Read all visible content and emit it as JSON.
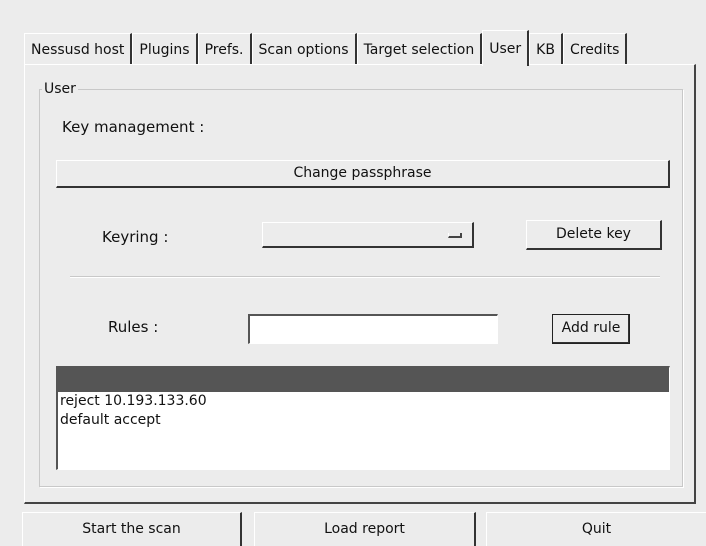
{
  "tabs": [
    {
      "label": "Nessusd host"
    },
    {
      "label": "Plugins"
    },
    {
      "label": "Prefs."
    },
    {
      "label": "Scan options"
    },
    {
      "label": "Target selection"
    },
    {
      "label": "User"
    },
    {
      "label": "KB"
    },
    {
      "label": "Credits"
    }
  ],
  "user_frame": {
    "title": "User",
    "key_management_label": "Key management :",
    "change_passphrase_label": "Change passphrase",
    "keyring_label": "Keyring :",
    "keyring_value": "",
    "delete_key_label": "Delete key",
    "rules_label": "Rules :",
    "rules_input_value": "",
    "add_rule_label": "Add rule",
    "rules_list": [
      "reject 10.193.133.60",
      "default accept"
    ]
  },
  "bottom_buttons": {
    "start_scan": "Start the scan",
    "load_report": "Load report",
    "quit": "Quit"
  }
}
